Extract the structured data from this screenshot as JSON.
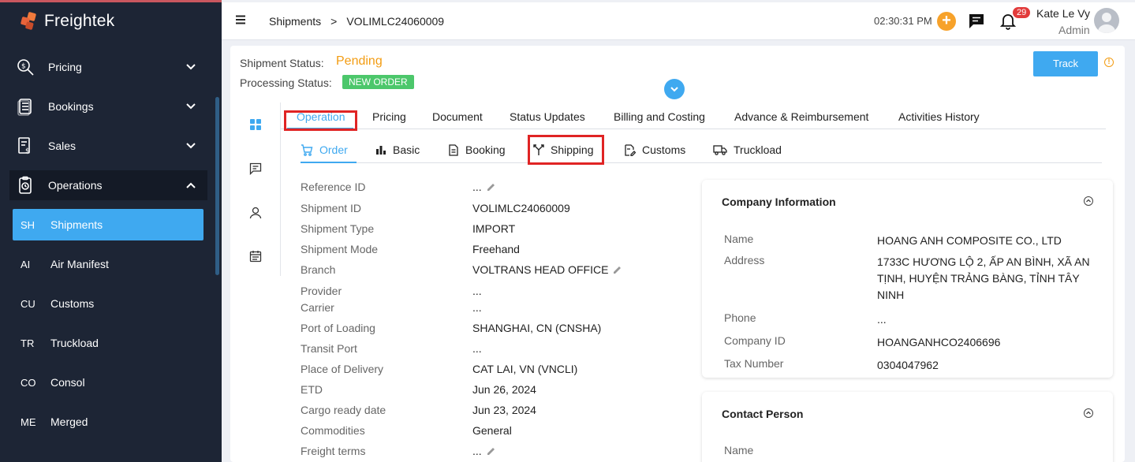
{
  "brand": {
    "name": "Freightek",
    "accent": "#e8643a"
  },
  "sidebar": {
    "groups": [
      {
        "label": "Pricing",
        "icon": "pricing-search-icon",
        "state": "collapsed"
      },
      {
        "label": "Bookings",
        "icon": "bookings-icon",
        "state": "collapsed"
      },
      {
        "label": "Sales",
        "icon": "sales-icon",
        "state": "collapsed"
      },
      {
        "label": "Operations",
        "icon": "operations-icon",
        "state": "expanded"
      }
    ],
    "sub_items": [
      {
        "abbr": "SH",
        "label": "Shipments",
        "active": true
      },
      {
        "abbr": "AI",
        "label": "Air Manifest"
      },
      {
        "abbr": "CU",
        "label": "Customs"
      },
      {
        "abbr": "TR",
        "label": "Truckload"
      },
      {
        "abbr": "CO",
        "label": "Consol"
      },
      {
        "abbr": "ME",
        "label": "Merged"
      }
    ]
  },
  "topbar": {
    "breadcrumb": {
      "root": "Shipments",
      "separator": ">",
      "current": "VOLIMLC24060009"
    },
    "clock": "02:30:31 PM",
    "notifications_count": "29",
    "user_name": "Kate Le Vy",
    "user_role": "Admin"
  },
  "status": {
    "shipment_label": "Shipment Status:",
    "shipment_value": "Pending",
    "processing_label": "Processing Status:",
    "processing_value": "NEW ORDER",
    "track_label": "Track"
  },
  "tabs": [
    "Operation",
    "Pricing",
    "Document",
    "Status Updates",
    "Billing and Costing",
    "Advance & Reimbursement",
    "Activities History"
  ],
  "subtabs": [
    "Order",
    "Basic",
    "Booking",
    "Shipping",
    "Customs",
    "Truckload"
  ],
  "order_fields": [
    {
      "label": "Reference ID",
      "value": "..."
    },
    {
      "label": "Shipment ID",
      "value": "VOLIMLC24060009"
    },
    {
      "label": "Shipment Type",
      "value": "IMPORT"
    },
    {
      "label": "Shipment Mode",
      "value": "Freehand"
    },
    {
      "label": "Branch",
      "value": "VOLTRANS HEAD OFFICE"
    },
    {
      "label": "Provider",
      "value": "..."
    },
    {
      "label": "Carrier",
      "value": "..."
    },
    {
      "label": "Port of Loading",
      "value": "SHANGHAI, CN (CNSHA)"
    },
    {
      "label": "Transit Port",
      "value": "..."
    },
    {
      "label": "Place of Delivery",
      "value": "CAT LAI, VN (VNCLI)"
    },
    {
      "label": "ETD",
      "value": "Jun 26, 2024"
    },
    {
      "label": "Cargo ready date",
      "value": "Jun 23, 2024"
    },
    {
      "label": "Commodities",
      "value": "General"
    },
    {
      "label": "Freight terms",
      "value": "..."
    }
  ],
  "company_info": {
    "title": "Company Information",
    "rows": [
      {
        "label": "Name",
        "value": "HOANG ANH COMPOSITE CO., LTD"
      },
      {
        "label": "Address",
        "value": "1733C HƯƠNG LỘ 2, ẤP AN BÌNH, XÃ AN TỊNH, HUYỆN TRẢNG BÀNG, TỈNH TÂY NINH"
      },
      {
        "label": "Phone",
        "value": "..."
      },
      {
        "label": "Company ID",
        "value": "HOANGANHCO2406696"
      },
      {
        "label": "Tax Number",
        "value": "0304047962"
      }
    ]
  },
  "contact_person": {
    "title": "Contact Person",
    "rows": [
      {
        "label": "Name",
        "value": ""
      }
    ]
  }
}
